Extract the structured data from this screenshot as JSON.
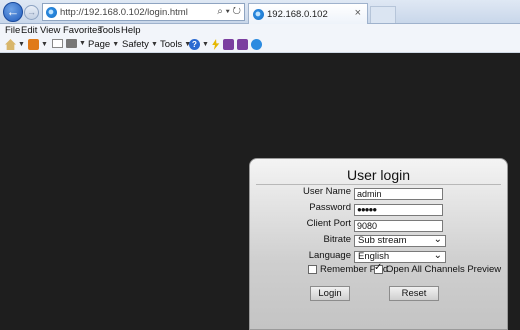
{
  "browser": {
    "address_url": "http://192.168.0.102/login.html",
    "address_controls": "⌕ ▾ ↻",
    "tab_title": "192.168.0.102",
    "tab_close": "×",
    "back_glyph": "←",
    "forward_glyph": "→",
    "menu": [
      "File",
      "Edit",
      "View",
      "Favorites",
      "Tools",
      "Help"
    ],
    "commands": {
      "page": "Page",
      "safety": "Safety",
      "tools": "Tools"
    }
  },
  "login": {
    "title": "User login",
    "username_label": "User Name",
    "username_value": "admin",
    "password_label": "Password",
    "password_value": "●●●●●",
    "client_port_label": "Client Port",
    "client_port_value": "9080",
    "bitrate_label": "Bitrate",
    "bitrate_value": "Sub stream",
    "language_label": "Language",
    "language_value": "English",
    "remember_label": "Remember Pwd",
    "remember_checked": false,
    "preview_label": "Open All Channels Preview",
    "preview_checked": true,
    "login_button": "Login",
    "reset_button": "Reset"
  },
  "colors": {
    "content_bg": "#1e1e1e",
    "panel_bg": "#d4d4d4",
    "chrome_bg": "#f2f5fa"
  }
}
